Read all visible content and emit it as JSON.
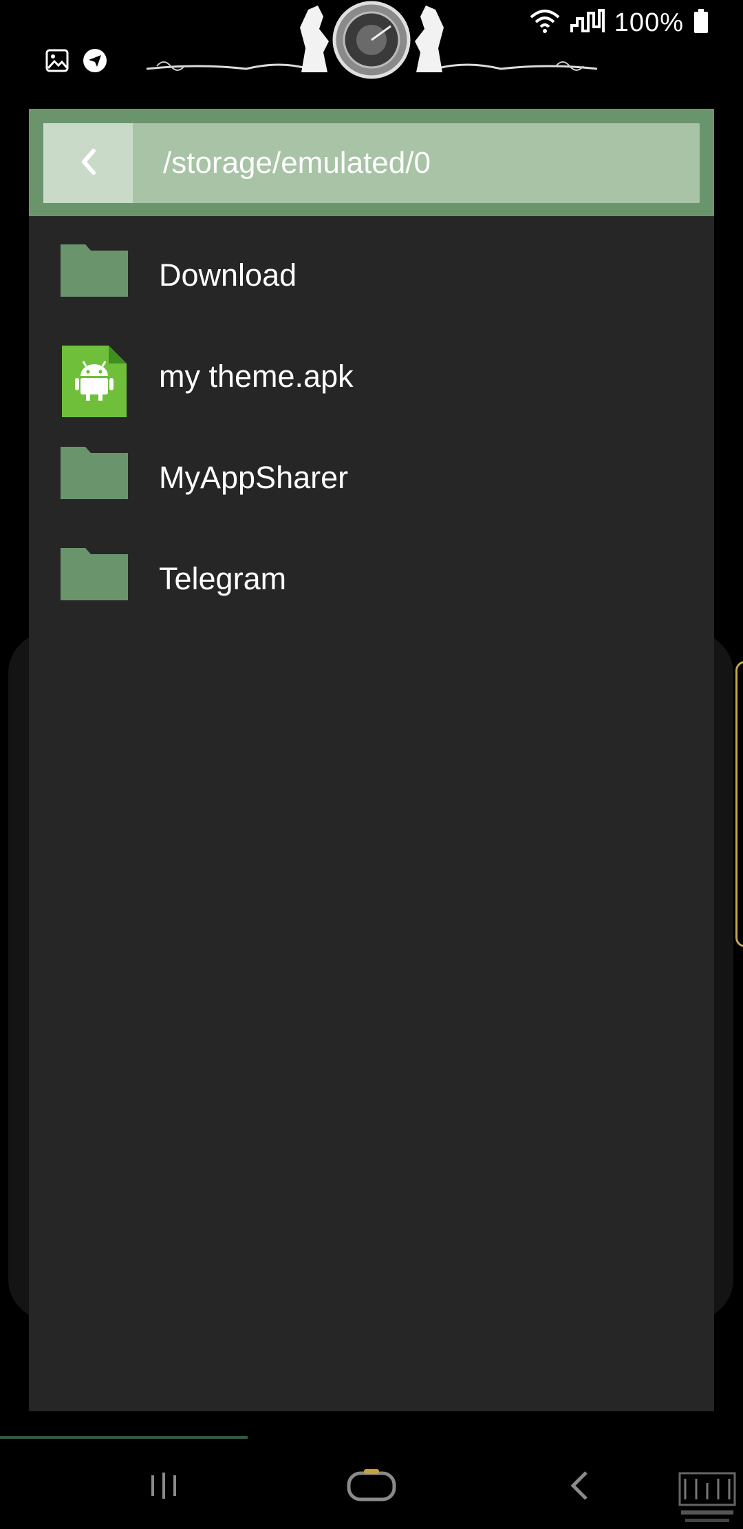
{
  "status_bar": {
    "battery_text": "100%",
    "left_icons": [
      "gallery-icon",
      "telegram-icon"
    ],
    "right_icons": [
      "wifi-icon",
      "signal-icon",
      "battery-icon"
    ]
  },
  "dialog": {
    "path": "/storage/emulated/0",
    "back_icon": "chevron-left-icon",
    "items": [
      {
        "name": "Download",
        "type": "folder"
      },
      {
        "name": "my theme.apk",
        "type": "apk"
      },
      {
        "name": "MyAppSharer",
        "type": "folder"
      },
      {
        "name": "Telegram",
        "type": "folder"
      }
    ]
  },
  "nav": {
    "buttons": [
      "recents-button",
      "home-button",
      "back-button"
    ]
  },
  "colors": {
    "header": "#6a956c",
    "path_bar": "#a8c3a6",
    "back_button": "#c9dbc8",
    "folder": "#6a956c",
    "apk": "#6fbf3a",
    "dialog_bg": "#262626",
    "home_accent": "#c8a040"
  }
}
